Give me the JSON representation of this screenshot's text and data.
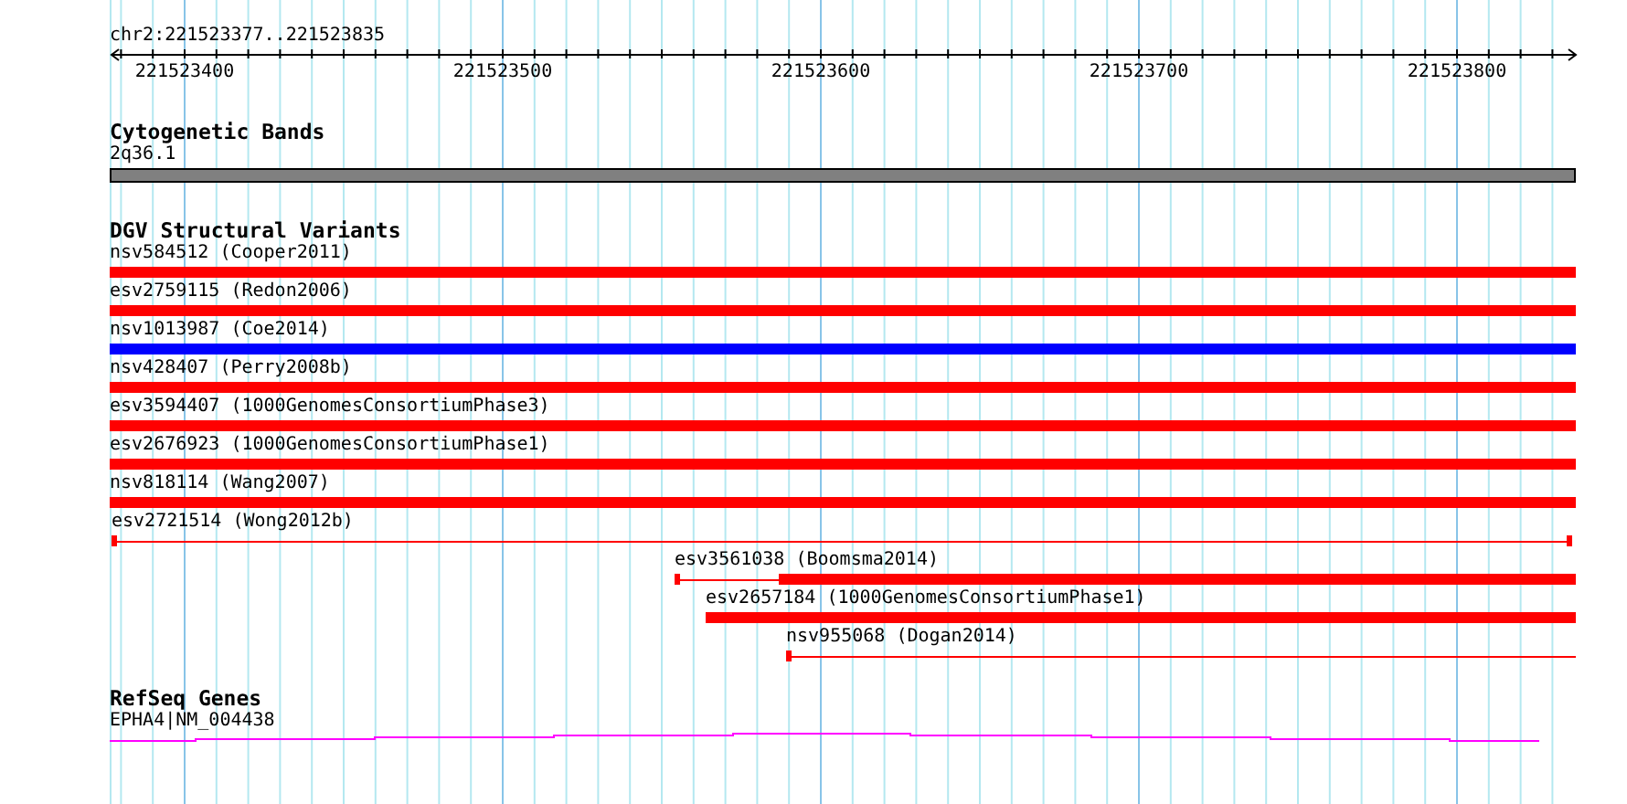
{
  "location": "chr2:221523377..221523835",
  "ruler": {
    "labels": [
      "221523400",
      "221523500",
      "221523600",
      "221523700",
      "221523800"
    ]
  },
  "cytogenetic_bands": {
    "title": "Cytogenetic Bands",
    "band": {
      "label": "2q36.1",
      "color": "#808080"
    }
  },
  "dgv": {
    "title": "DGV Structural Variants",
    "variants": [
      {
        "label": "nsv584512 (Cooper2011)",
        "color": "#ff0000",
        "kind": "thick"
      },
      {
        "label": "esv2759115 (Redon2006)",
        "color": "#ff0000",
        "kind": "thick"
      },
      {
        "label": "nsv1013987 (Coe2014)",
        "color": "#0000ff",
        "kind": "thick"
      },
      {
        "label": "nsv428407 (Perry2008b)",
        "color": "#ff0000",
        "kind": "thick"
      },
      {
        "label": "esv3594407 (1000GenomesConsortiumPhase3)",
        "color": "#ff0000",
        "kind": "thick"
      },
      {
        "label": "esv2676923 (1000GenomesConsortiumPhase1)",
        "color": "#ff0000",
        "kind": "thick"
      },
      {
        "label": "nsv818114 (Wang2007)",
        "color": "#ff0000",
        "kind": "thick"
      },
      {
        "label": "esv2721514 (Wong2012b)",
        "color": "#ff0000",
        "kind": "thin"
      },
      {
        "label": "esv3561038 (Boomsma2014)",
        "color": "#ff0000",
        "kind": "mixed"
      },
      {
        "label": "esv2657184 (1000GenomesConsortiumPhase1)",
        "color": "#ff0000",
        "kind": "thick"
      },
      {
        "label": "nsv955068 (Dogan2014)",
        "color": "#ff0000",
        "kind": "thin"
      }
    ]
  },
  "refseq": {
    "title": "RefSeq Genes",
    "gene": {
      "label": "EPHA4|NM_004438"
    }
  }
}
